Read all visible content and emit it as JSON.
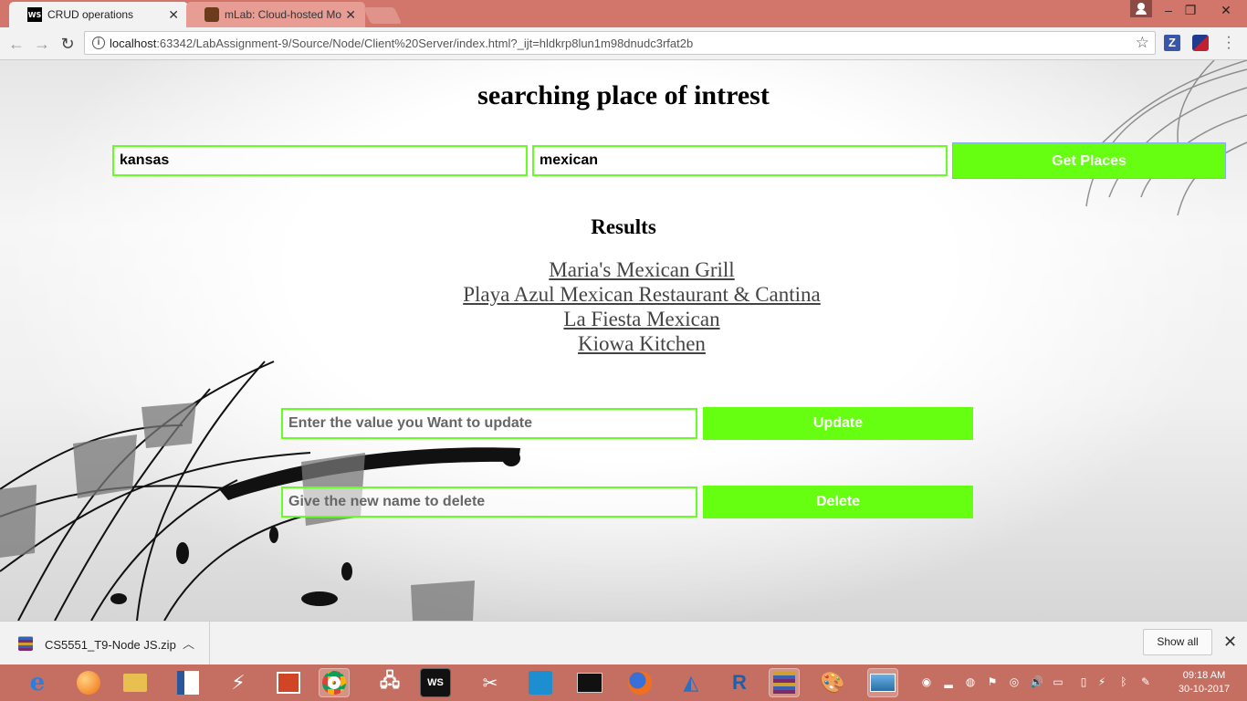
{
  "browser": {
    "tabs": [
      {
        "title": "CRUD operations",
        "favicon": "webstorm-icon",
        "active": true
      },
      {
        "title": "mLab: Cloud-hosted Mo",
        "favicon": "mlab-icon",
        "active": false
      }
    ],
    "url": {
      "host": "localhost",
      "rest": ":63342/LabAssignment-9/Source/Node/Client%20Server/index.html?_ijt=hldkrp8lun1m98dnudc3rfat2b"
    }
  },
  "page": {
    "title": "searching place of intrest",
    "search": {
      "location_value": "kansas",
      "query_value": "mexican",
      "button_label": "Get Places"
    },
    "results_heading": "Results",
    "results": [
      "Maria's Mexican Grill",
      "Playa Azul Mexican Restaurant & Cantina",
      "La Fiesta Mexican",
      "Kiowa Kitchen"
    ],
    "update": {
      "placeholder": "Enter the value you Want to update",
      "button_label": "Update"
    },
    "delete": {
      "placeholder": "Give the new name to delete",
      "button_label": "Delete"
    },
    "accent_color": "#66ff11"
  },
  "downloads": {
    "file_name": "CS5551_T9-Node JS.zip",
    "show_all_label": "Show all"
  },
  "taskbar": {
    "time": "09:18 AM",
    "date": "30-10-2017",
    "ws_label": "WS"
  }
}
